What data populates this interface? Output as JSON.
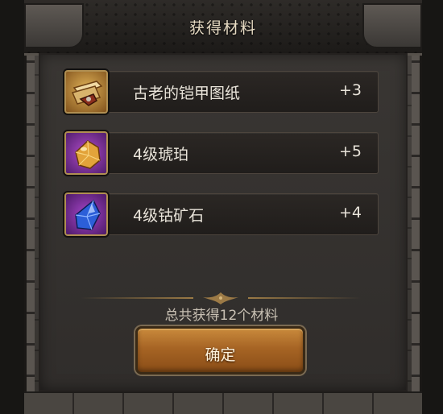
{
  "dialog": {
    "title": "获得材料",
    "items": [
      {
        "name": "古老的铠甲图纸",
        "quantity": "+3",
        "icon": "armor-blueprint-icon"
      },
      {
        "name": "4级琥珀",
        "quantity": "+5",
        "icon": "amber-gem-icon"
      },
      {
        "name": "4级钴矿石",
        "quantity": "+4",
        "icon": "cobalt-ore-icon"
      }
    ],
    "total_text": "总共获得12个材料",
    "confirm_label": "确定"
  }
}
